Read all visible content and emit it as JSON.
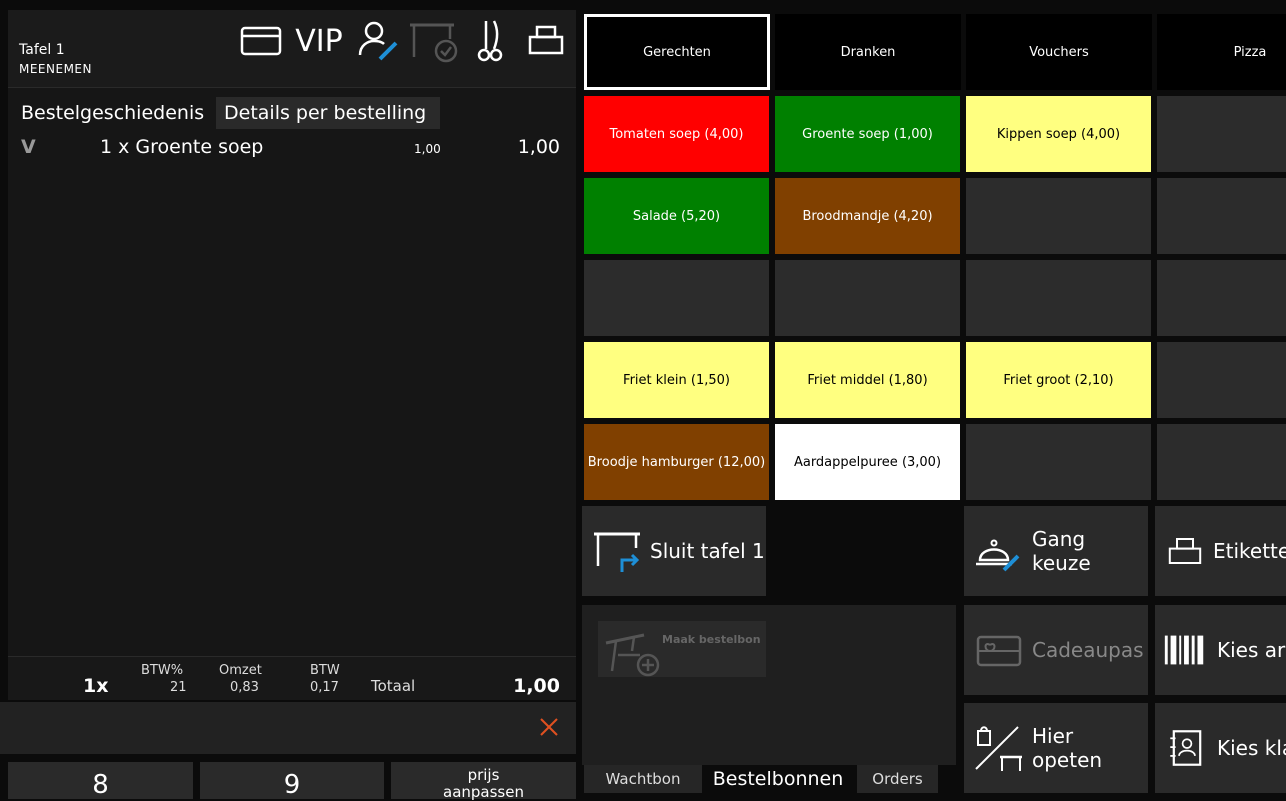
{
  "header": {
    "table_name": "Tafel 1",
    "table_mode": "MEENEMEN",
    "vip_label": "VIP",
    "icons": [
      "card-icon",
      "vip-label",
      "user-edit-icon",
      "table-check-icon",
      "knife-icon",
      "printer-icon"
    ]
  },
  "tabs": {
    "history": "Bestelgeschiedenis",
    "details": "Details per bestelling"
  },
  "order": {
    "rows": [
      {
        "status": "V",
        "description": "1 x Groente soep",
        "unit_price": "1,00",
        "total": "1,00"
      }
    ]
  },
  "summary": {
    "quantity": "1x",
    "btw_pct_label": "BTW%",
    "btw_pct_value": "21",
    "omzet_label": "Omzet",
    "omzet_value": "0,83",
    "btw_label": "BTW",
    "btw_value": "0,17",
    "total_label": "Totaal",
    "total_value": "1,00"
  },
  "keypad": {
    "key_8": "8",
    "key_9": "9",
    "price_adjust_line1": "prijs",
    "price_adjust_line2": "aanpassen"
  },
  "categories": [
    "Gerechten",
    "Dranken",
    "Vouchers",
    "Pizza"
  ],
  "products": {
    "r0c0": "Tomaten soep (4,00)",
    "r0c1": "Groente soep (1,00)",
    "r0c2": "Kippen soep (4,00)",
    "r1c0": "Salade (5,20)",
    "r1c1": "Broodmandje (4,20)",
    "r3c0": "Friet klein (1,50)",
    "r3c1": "Friet middel (1,80)",
    "r3c2": "Friet groot (2,10)",
    "r4c0": "Broodje hamburger (12,00)",
    "r4c1": "Aardappelpuree (3,00)"
  },
  "colors": {
    "red": "#ff0000",
    "green": "#008000",
    "yellow": "#ffff80",
    "brown": "#804000",
    "white": "#ffffff",
    "accent_blue": "#1e8fd6",
    "close_orange": "#e05020"
  },
  "actions": {
    "close_table": "Sluit tafel 1",
    "course_choice": "Gang keuze",
    "labels": "Etikette",
    "make_order_slip": "Maak bestelbon",
    "gift_card": "Cadeaupas",
    "choose_article": "Kies ar",
    "eat_here": "Hier opeten",
    "choose_customer": "Kies kla"
  },
  "bottom_tabs": {
    "waiting": "Wachtbon",
    "order_slips": "Bestelbonnen",
    "orders": "Orders"
  }
}
